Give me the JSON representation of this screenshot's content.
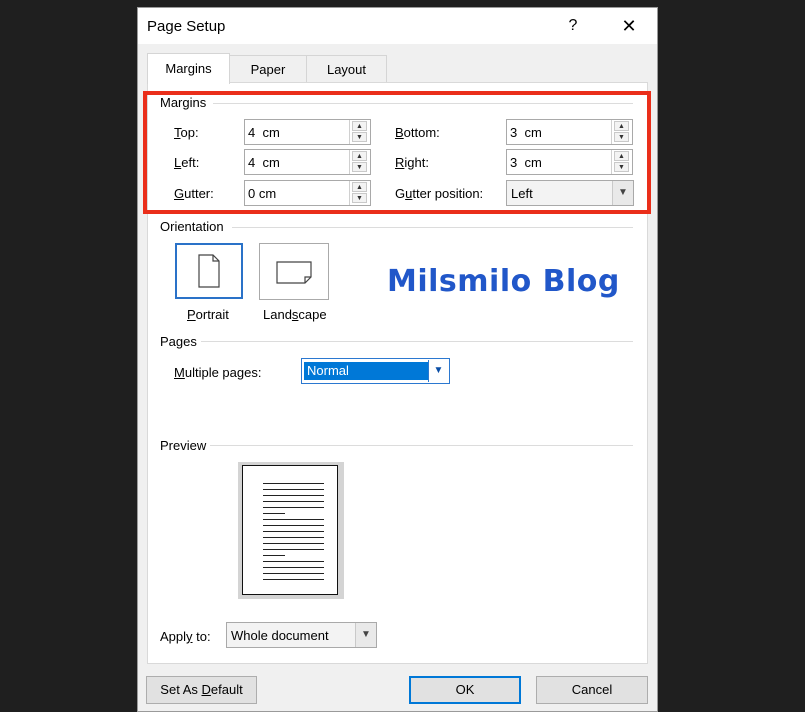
{
  "dialog": {
    "title": "Page Setup",
    "help": "?",
    "close": "✕"
  },
  "tabs": [
    {
      "label": "Margins",
      "active": true
    },
    {
      "label": "Paper",
      "active": false
    },
    {
      "label": "Layout",
      "active": false
    }
  ],
  "margins": {
    "section_label": "Margins",
    "top": {
      "label": "Top:",
      "value": "4  cm"
    },
    "left": {
      "label": "Left:",
      "value": "4  cm"
    },
    "gutter": {
      "label": "Gutter:",
      "value": "0 cm"
    },
    "bottom": {
      "label": "Bottom:",
      "value": "3  cm"
    },
    "right": {
      "label": "Right:",
      "value": "3  cm"
    },
    "gutter_position": {
      "label": "Gutter position:",
      "value": "Left"
    }
  },
  "orientation": {
    "section_label": "Orientation",
    "portrait": "Portrait",
    "landscape": "Landscape",
    "selected": "portrait"
  },
  "watermark": "Milsmilo Blog",
  "pages": {
    "section_label": "Pages",
    "multiple_pages_label": "Multiple pages:",
    "multiple_pages_value": "Normal"
  },
  "preview": {
    "section_label": "Preview"
  },
  "apply_to": {
    "label": "Apply to:",
    "value": "Whole document"
  },
  "buttons": {
    "set_default": "Set As Default",
    "ok": "OK",
    "cancel": "Cancel"
  },
  "colors": {
    "highlight_box": "#ea2e1a",
    "accent": "#0078d7",
    "watermark": "#2157c9"
  },
  "icons": {
    "spin_up": "triangle-up",
    "spin_down": "triangle-down",
    "dropdown": "chevron-down"
  }
}
